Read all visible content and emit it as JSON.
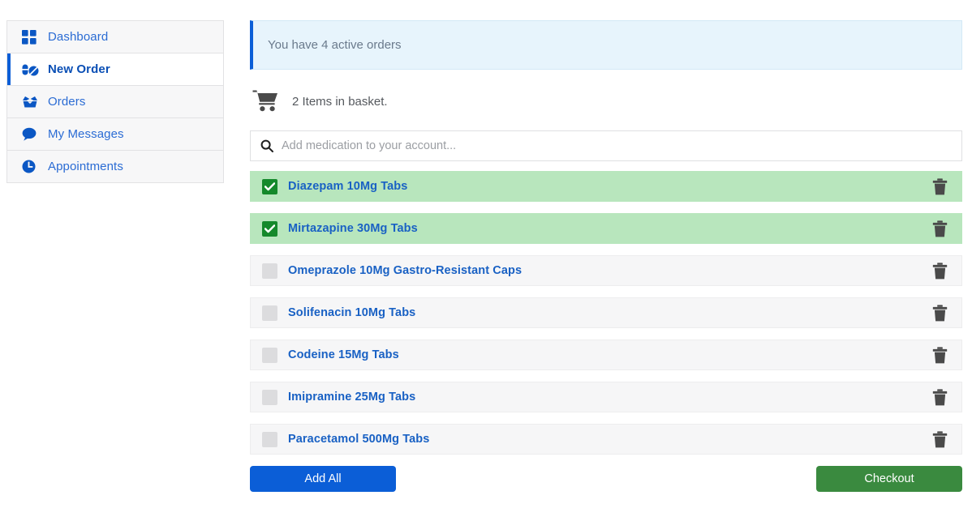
{
  "sidebar": {
    "items": [
      {
        "label": "Dashboard",
        "icon": "grid-icon",
        "active": false
      },
      {
        "label": "New Order",
        "icon": "pills-icon",
        "active": true
      },
      {
        "label": "Orders",
        "icon": "open-box-icon",
        "active": false
      },
      {
        "label": "My Messages",
        "icon": "speech-bubble-icon",
        "active": false
      },
      {
        "label": "Appointments",
        "icon": "clock-icon",
        "active": false
      }
    ]
  },
  "alert": {
    "text": "You have 4 active orders",
    "accent_color": "#0b5ed7",
    "background_color": "#e7f4fc"
  },
  "basket": {
    "icon": "shopping-cart-icon",
    "text": "2 Items in basket.",
    "count": 2
  },
  "search": {
    "icon": "search-icon",
    "placeholder": "Add medication to your account...",
    "value": ""
  },
  "medications": [
    {
      "name": "Diazepam 10Mg Tabs",
      "selected": true
    },
    {
      "name": "Mirtazapine 30Mg Tabs",
      "selected": true
    },
    {
      "name": "Omeprazole 10Mg Gastro-Resistant Caps",
      "selected": false
    },
    {
      "name": "Solifenacin 10Mg Tabs",
      "selected": false
    },
    {
      "name": "Codeine 15Mg Tabs",
      "selected": false
    },
    {
      "name": "Imipramine 25Mg Tabs",
      "selected": false
    },
    {
      "name": "Paracetamol 500Mg Tabs",
      "selected": false
    }
  ],
  "row_delete_icon": "trash-icon",
  "actions": {
    "add_all_label": "Add All",
    "add_all_color": "#0b5ed7",
    "checkout_label": "Checkout",
    "checkout_color": "#3a8a3f"
  },
  "colors": {
    "selected_row": "#b8e6bd",
    "unselected_row": "#f6f6f7",
    "link_blue": "#1961c4",
    "check_green": "#15892b"
  }
}
